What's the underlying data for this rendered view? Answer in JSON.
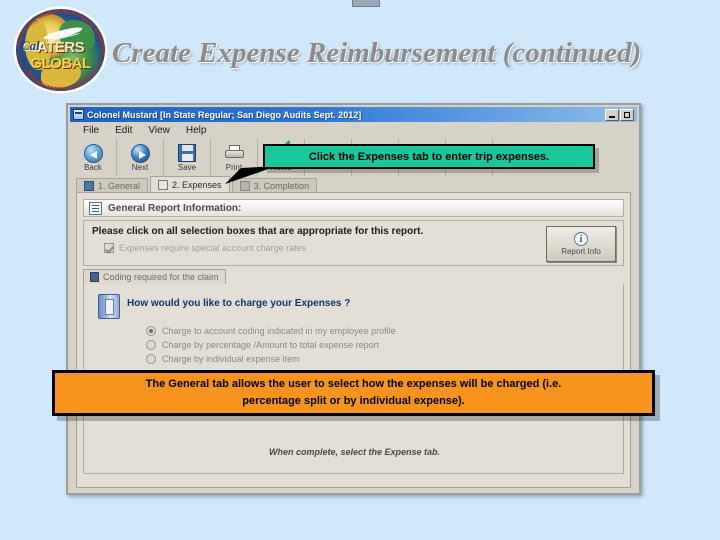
{
  "slide": {
    "title": "Create Expense Reimbursement (continued)",
    "logo": {
      "name": "calaters-global-logo",
      "word_top": "ATERS",
      "word_bottom": "GLOBAL",
      "word_cal": "Cal",
      "arc_top": "California Automated Travel Expense",
      "arc_bottom": "Reimbursement System"
    },
    "background_color": "#cfe8fb",
    "title_color": "#8c8c8c"
  },
  "window": {
    "title": "Colonel Mustard [In State Regular; San Diego Audits Sept. 2012]",
    "title_icon": "app-window-icon",
    "buttons": [
      {
        "name": "minimize-button",
        "glyph": "minimize-icon"
      },
      {
        "name": "maximize-button",
        "glyph": "maximize-icon"
      }
    ],
    "menu": [
      {
        "label": "File"
      },
      {
        "label": "Edit"
      },
      {
        "label": "View"
      },
      {
        "label": "Help"
      }
    ],
    "toolbar": [
      {
        "label": "Back",
        "icon": "back-arrow-icon"
      },
      {
        "label": "Next",
        "icon": "next-arrow-icon"
      },
      {
        "label": "Save",
        "icon": "floppy-disk-icon"
      },
      {
        "label": "Print",
        "icon": "printer-icon"
      },
      {
        "label": "Notes",
        "icon": "notes-pencil-icon"
      },
      {
        "label": "",
        "icon": "document-icon"
      },
      {
        "label": "",
        "icon": "folder-icon"
      },
      {
        "label": "",
        "icon": "magnifier-icon"
      },
      {
        "label": "",
        "icon": "green-document-icon"
      }
    ]
  },
  "tabs": [
    {
      "label": "1. General",
      "selected": false,
      "icon": "general-tab-icon"
    },
    {
      "label": "2. Expenses",
      "selected": true,
      "icon": "expenses-tab-icon"
    },
    {
      "label": "3. Completion",
      "selected": false,
      "icon": "completion-tab-icon"
    }
  ],
  "form": {
    "section_header": "General Report Information:",
    "section_header_icon": "report-info-icon",
    "selection_instruction": "Please click on all selection boxes that are appropriate for this report.",
    "checkbox": {
      "label": "Expenses require special account charge rates",
      "checked": true,
      "enabled": false
    },
    "report_info_button": {
      "label": "Report Info",
      "icon": "info-circle-icon"
    },
    "coding_tab": {
      "label": "Coding required for the claim",
      "icon": "coding-tab-icon"
    },
    "charge": {
      "icon": "charge-expenses-icon",
      "question": "How would you like to charge your Expenses ?",
      "options": [
        {
          "label": "Charge to account coding indicated in my employee profile",
          "selected": true
        },
        {
          "label": "Charge by percentage /Amount to total expense report",
          "selected": false
        },
        {
          "label": "Charge by individual expense item",
          "selected": false
        }
      ]
    },
    "footer_note": "When complete, select the Expense tab."
  },
  "callouts": {
    "green": {
      "text": "Click the Expenses tab to enter trip expenses.",
      "color": "#18c79a"
    },
    "orange": {
      "line1": "The General tab allows the user to select how the expenses will be charged (i.e.",
      "line2": "percentage split or by individual expense).",
      "color": "#f7941e"
    }
  }
}
